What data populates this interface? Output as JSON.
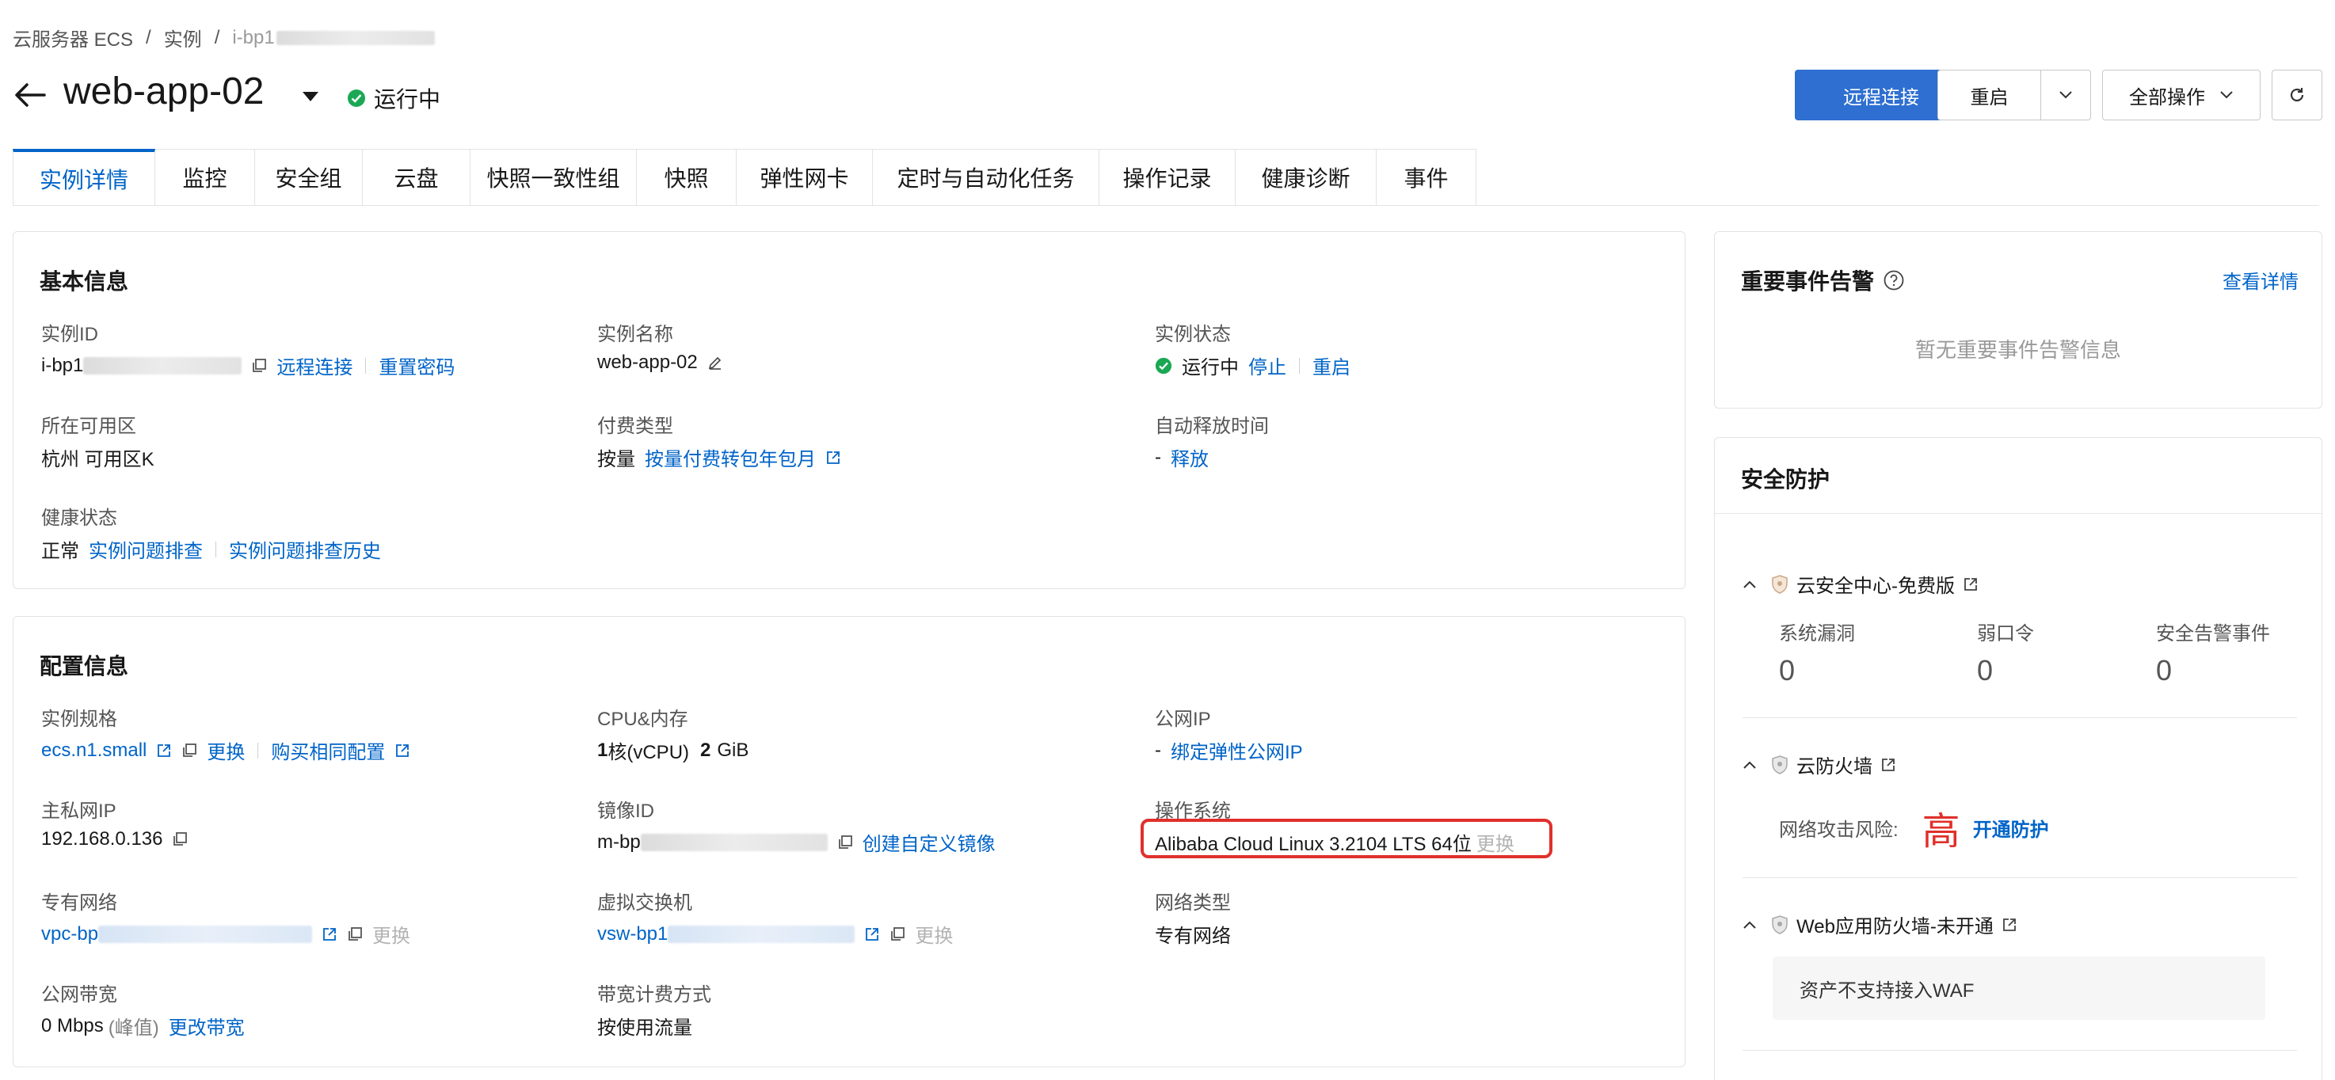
{
  "breadcrumb": {
    "items": [
      "云服务器 ECS",
      "实例",
      "i-bp1"
    ],
    "separator": "/"
  },
  "header": {
    "title": "web-app-02",
    "status": "运行中",
    "buttons": {
      "remote": "远程连接",
      "restart": "重启",
      "all_ops": "全部操作"
    }
  },
  "tabs": [
    "实例详情",
    "监控",
    "安全组",
    "云盘",
    "快照一致性组",
    "快照",
    "弹性网卡",
    "定时与自动化任务",
    "操作记录",
    "健康诊断",
    "事件"
  ],
  "basic": {
    "title": "基本信息",
    "instance_id_label": "实例ID",
    "instance_id_value": "i-bp1",
    "remote_link": "远程连接",
    "reset_pwd_link": "重置密码",
    "instance_name_label": "实例名称",
    "instance_name_value": "web-app-02",
    "instance_status_label": "实例状态",
    "instance_status_value": "运行中",
    "stop_link": "停止",
    "restart_link": "重启",
    "zone_label": "所在可用区",
    "zone_value": "杭州 可用区K",
    "billing_label": "付费类型",
    "billing_value": "按量",
    "billing_link": "按量付费转包年包月",
    "auto_release_label": "自动释放时间",
    "auto_release_value": "-",
    "release_link": "释放",
    "health_label": "健康状态",
    "health_value": "正常",
    "troubleshoot_link": "实例问题排查",
    "troubleshoot_history_link": "实例问题排查历史"
  },
  "config": {
    "title": "配置信息",
    "spec_label": "实例规格",
    "spec_value": "ecs.n1.small",
    "spec_change": "更换",
    "buy_same": "购买相同配置",
    "cpu_label": "CPU&内存",
    "cpu_value_num": "1",
    "cpu_value_unit": "核(vCPU)",
    "mem_value_num": "2",
    "mem_value_unit": "GiB",
    "public_ip_label": "公网IP",
    "public_ip_value": "-",
    "bind_eip": "绑定弹性公网IP",
    "private_ip_label": "主私网IP",
    "private_ip_value": "192.168.0.136",
    "image_id_label": "镜像ID",
    "image_id_value": "m-bp",
    "create_image": "创建自定义镜像",
    "os_label": "操作系统",
    "os_value": "Alibaba Cloud Linux 3.2104 LTS 64位",
    "os_change": "更换",
    "vpc_label": "专有网络",
    "vpc_value": "vpc-bp",
    "vpc_change": "更换",
    "vswitch_label": "虚拟交换机",
    "vswitch_value": "vsw-bp1",
    "vswitch_change": "更换",
    "network_type_label": "网络类型",
    "network_type_value": "专有网络",
    "bandwidth_label": "公网带宽",
    "bandwidth_value": "0 Mbps",
    "bandwidth_peak": "(峰值)",
    "change_bandwidth": "更改带宽",
    "bw_billing_label": "带宽计费方式",
    "bw_billing_value": "按使用流量"
  },
  "events": {
    "title": "重要事件告警",
    "view_details": "查看详情",
    "empty": "暂无重要事件告警信息"
  },
  "security": {
    "title": "安全防护",
    "center_title": "云安全中心-免费版",
    "vuln_label": "系统漏洞",
    "vuln_value": "0",
    "weak_pwd_label": "弱口令",
    "weak_pwd_value": "0",
    "alerts_label": "安全告警事件",
    "alerts_value": "0",
    "firewall_title": "云防火墙",
    "risk_label": "网络攻击风险:",
    "risk_level": "高",
    "enable_protection": "开通防护",
    "waf_title": "Web应用防火墙-未开通",
    "waf_note": "资产不支持接入WAF"
  },
  "colors": {
    "accent": "#0064c8",
    "primary_button": "#2e6fd1",
    "success": "#1ba854",
    "danger": "#e0302b"
  }
}
